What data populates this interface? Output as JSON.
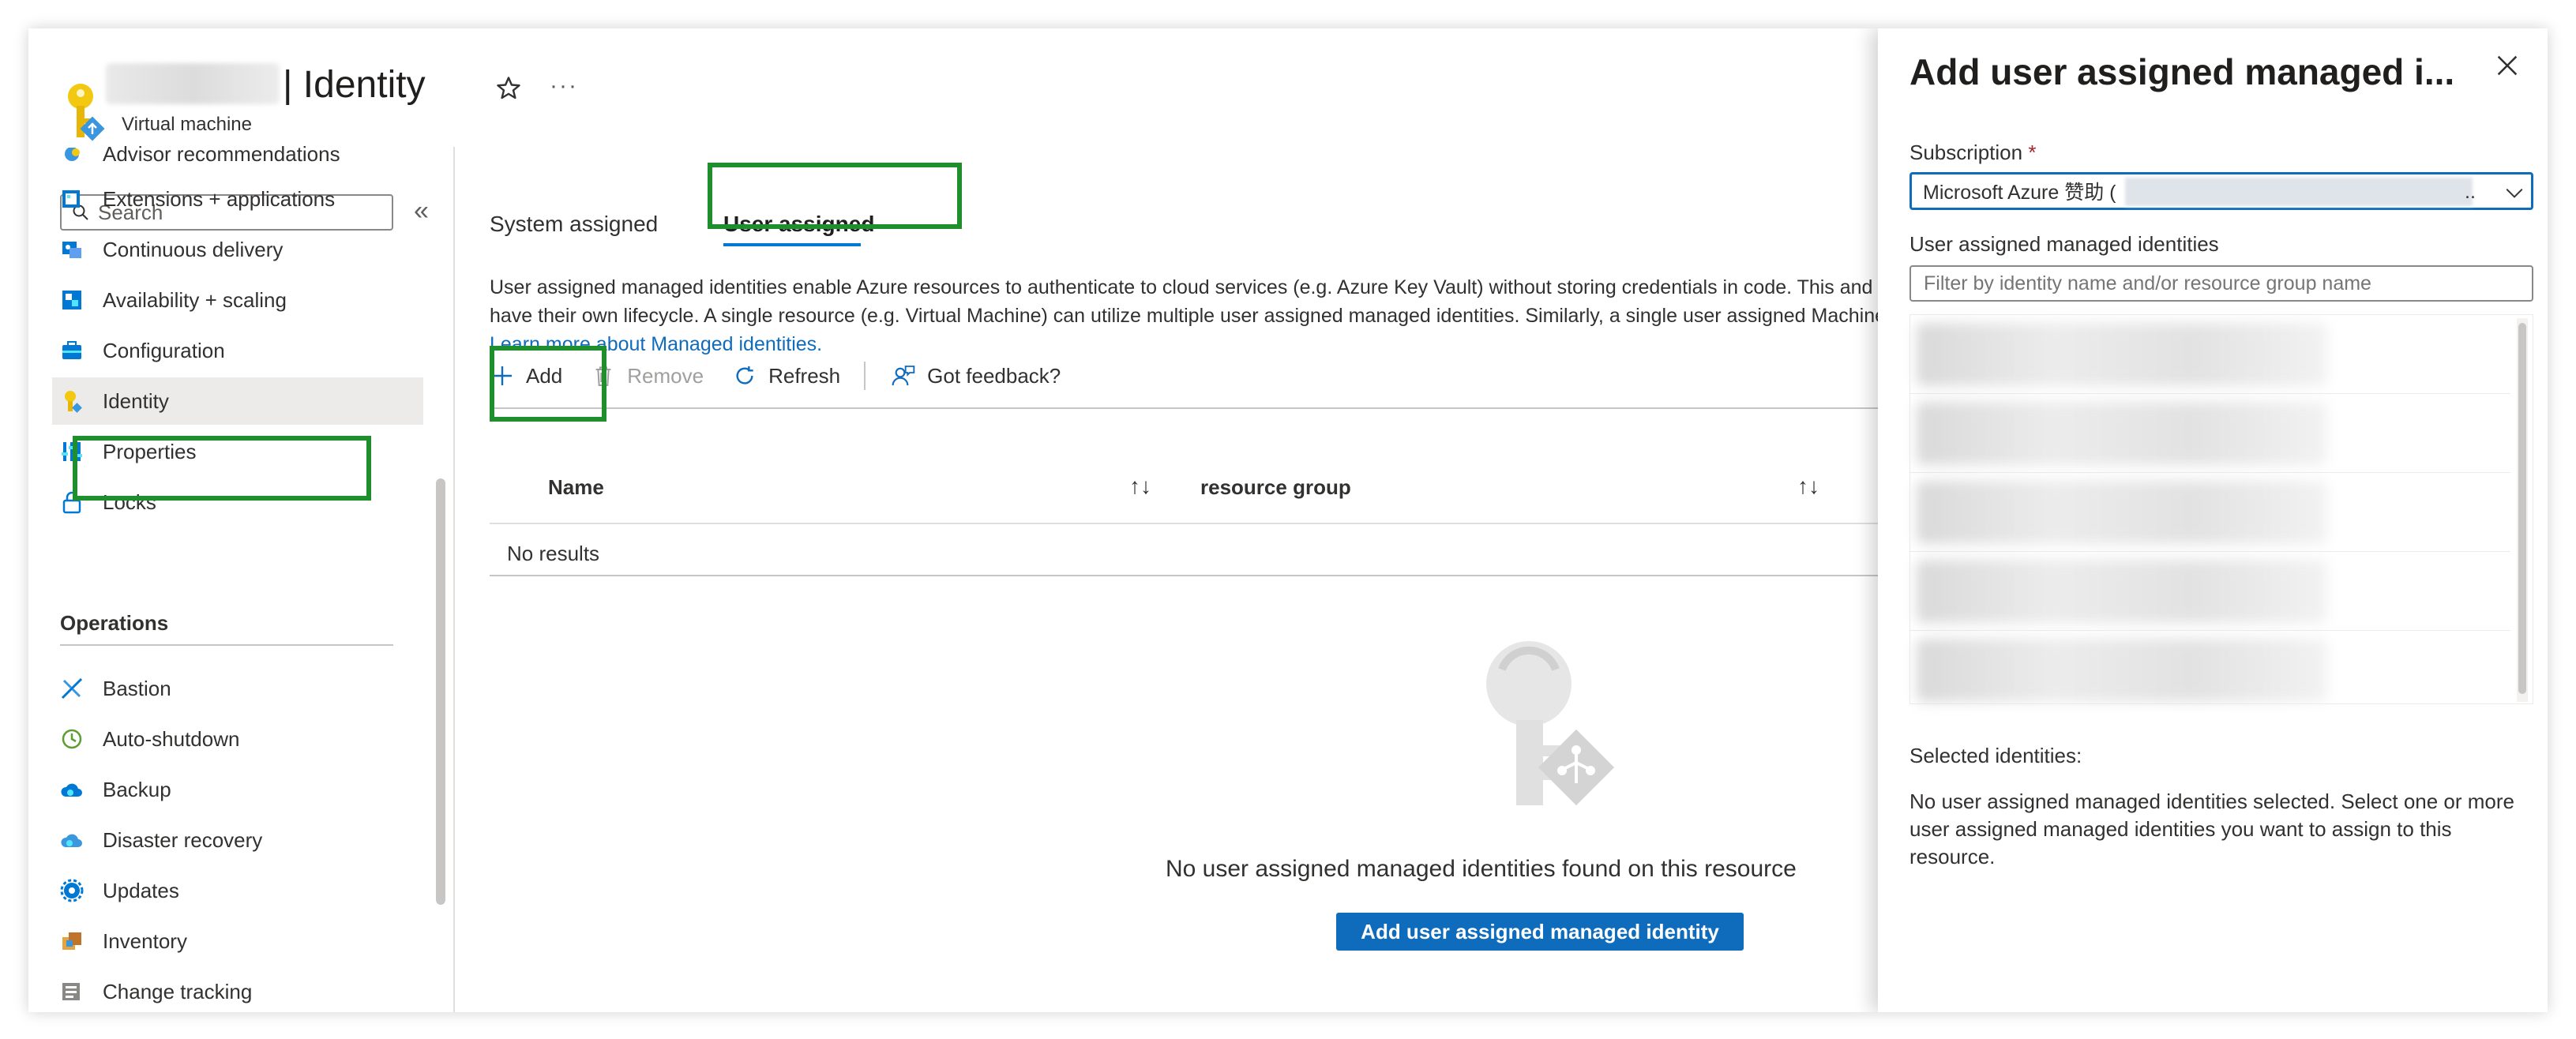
{
  "header": {
    "title": "| Identity",
    "subtitle": "Virtual machine"
  },
  "sidebar": {
    "search_placeholder": "Search",
    "items": [
      {
        "label": "Advisor recommendations",
        "icon": "advisor-icon"
      },
      {
        "label": "Extensions + applications",
        "icon": "extensions-icon"
      },
      {
        "label": "Continuous delivery",
        "icon": "continuous-delivery-icon"
      },
      {
        "label": "Availability + scaling",
        "icon": "availability-icon"
      },
      {
        "label": "Configuration",
        "icon": "configuration-icon"
      },
      {
        "label": "Identity",
        "icon": "identity-key-icon",
        "selected": true
      },
      {
        "label": "Properties",
        "icon": "properties-icon"
      },
      {
        "label": "Locks",
        "icon": "lock-icon"
      }
    ],
    "operations_heading": "Operations",
    "operations": [
      {
        "label": "Bastion",
        "icon": "bastion-icon"
      },
      {
        "label": "Auto-shutdown",
        "icon": "clock-icon"
      },
      {
        "label": "Backup",
        "icon": "backup-cloud-icon"
      },
      {
        "label": "Disaster recovery",
        "icon": "disaster-recovery-icon"
      },
      {
        "label": "Updates",
        "icon": "gear-icon"
      },
      {
        "label": "Inventory",
        "icon": "inventory-icon"
      },
      {
        "label": "Change tracking",
        "icon": "change-tracking-icon"
      }
    ]
  },
  "main": {
    "tabs": [
      {
        "label": "System assigned"
      },
      {
        "label": "User assigned",
        "selected": true
      }
    ],
    "description": "User assigned managed identities enable Azure resources to authenticate to cloud services (e.g. Azure Key Vault) without storing credentials in code. This and have their own lifecycle. A single resource (e.g. Virtual Machine) can utilize multiple user assigned managed identities. Similarly, a single user assigned Machine).",
    "learn_more": "Learn more about Managed identities.",
    "toolbar": {
      "add": "Add",
      "remove": "Remove",
      "refresh": "Refresh",
      "feedback": "Got feedback?"
    },
    "table": {
      "columns": [
        "Name",
        "resource group"
      ],
      "sort_glyph": "↑↓",
      "empty_row": "No results"
    },
    "empty_state": {
      "text": "No user assigned managed identities found on this resource",
      "button": "Add user assigned managed identity"
    }
  },
  "panel": {
    "title": "Add user assigned managed i...",
    "subscription_label": "Subscription",
    "required_mark": "*",
    "subscription_value": "Microsoft Azure 赞助 (",
    "subscription_ellipsis": "..",
    "identities_label": "User assigned managed identities",
    "filter_placeholder": "Filter by identity name and/or resource group name",
    "selected_label": "Selected identities:",
    "selected_text": "No user assigned managed identities selected. Select one or more user assigned managed identities you want to assign to this resource."
  },
  "colors": {
    "accent": "#0f6cbd",
    "highlight": "#1f8f2e",
    "required": "#a4262c"
  }
}
